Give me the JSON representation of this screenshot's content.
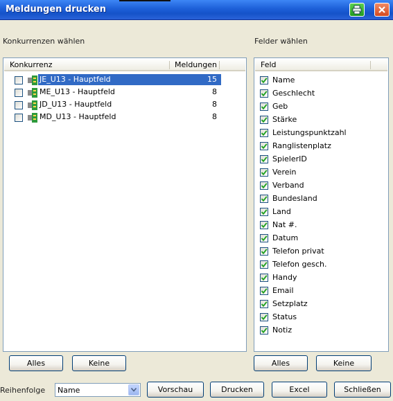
{
  "window": {
    "title": "Meldungen drucken"
  },
  "left": {
    "section_label": "Konkurrenzen wählen",
    "columns": {
      "name": "Konkurrenz",
      "count": "Meldungen"
    },
    "rows": [
      {
        "name": "JE_U13 - Hauptfeld",
        "count": "15",
        "selected": true
      },
      {
        "name": "ME_U13 - Hauptfeld",
        "count": "8"
      },
      {
        "name": "JD_U13 - Hauptfeld",
        "count": "8"
      },
      {
        "name": "MD_U13 - Hauptfeld",
        "count": "8"
      }
    ],
    "btn_all": "Alles",
    "btn_none": "Keine"
  },
  "right": {
    "section_label": "Felder wählen",
    "column": "Feld",
    "fields": [
      "Name",
      "Geschlecht",
      "Geb",
      "Stärke",
      "Leistungspunktzahl",
      "Ranglistenplatz",
      "SpielerID",
      "Verein",
      "Verband",
      "Bundesland",
      "Land",
      "Nat #.",
      "Datum",
      "Telefon privat",
      "Telefon gesch.",
      "Handy",
      "Email",
      "Setzplatz",
      "Status",
      "Notiz"
    ],
    "btn_all": "Alles",
    "btn_none": "Keine"
  },
  "footer": {
    "order_label": "Reihenfolge",
    "order_value": "Name",
    "preview": "Vorschau",
    "print": "Drucken",
    "excel": "Excel",
    "close": "Schließen"
  },
  "colors": {
    "titlebar": "#1d5fd8",
    "selection": "#316ac5",
    "checkmark": "#21a121",
    "dialog": "#ece9d8"
  }
}
